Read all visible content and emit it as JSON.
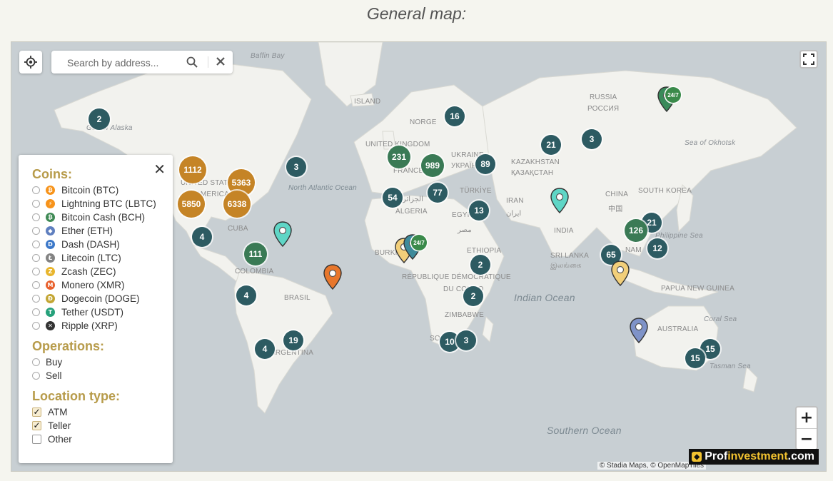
{
  "page": {
    "title": "General map:"
  },
  "search": {
    "placeholder": "Search by address..."
  },
  "attribution": "© Stadia Maps, © OpenMapTiles",
  "watermark": {
    "prefix": "Prof",
    "highlight": "investment",
    "suffix": ".com"
  },
  "filters": {
    "coins_title": "Coins:",
    "coins": [
      {
        "label": "Bitcoin (BTC)",
        "icon": "bitcoin-icon",
        "color": "#f7931a",
        "glyph": "₿"
      },
      {
        "label": "Lightning BTC (LBTC)",
        "icon": "lightning-icon",
        "color": "#f7931a",
        "glyph": "⚡"
      },
      {
        "label": "Bitcoin Cash (BCH)",
        "icon": "bitcoin-cash-icon",
        "color": "#3f8a55",
        "glyph": "₿"
      },
      {
        "label": "Ether (ETH)",
        "icon": "ether-icon",
        "color": "#5f7fbf",
        "glyph": "◆"
      },
      {
        "label": "Dash (DASH)",
        "icon": "dash-icon",
        "color": "#3b78c9",
        "glyph": "D"
      },
      {
        "label": "Litecoin (LTC)",
        "icon": "litecoin-icon",
        "color": "#838383",
        "glyph": "Ł"
      },
      {
        "label": "Zcash (ZEC)",
        "icon": "zcash-icon",
        "color": "#e8b52c",
        "glyph": "Z"
      },
      {
        "label": "Monero (XMR)",
        "icon": "monero-icon",
        "color": "#e8602c",
        "glyph": "M"
      },
      {
        "label": "Dogecoin (DOGE)",
        "icon": "dogecoin-icon",
        "color": "#c3a634",
        "glyph": "Ð"
      },
      {
        "label": "Tether (USDT)",
        "icon": "tether-icon",
        "color": "#26a17b",
        "glyph": "T"
      },
      {
        "label": "Ripple (XRP)",
        "icon": "ripple-icon",
        "color": "#333333",
        "glyph": "✕"
      }
    ],
    "operations_title": "Operations:",
    "operations": [
      {
        "label": "Buy"
      },
      {
        "label": "Sell"
      }
    ],
    "location_title": "Location type:",
    "location_types": [
      {
        "label": "ATM",
        "checked": true
      },
      {
        "label": "Teller",
        "checked": true
      },
      {
        "label": "Other",
        "checked": false
      }
    ]
  },
  "labels": {
    "baffin_bay": "Baffin Bay",
    "island": "ISLAND",
    "norge": "NORGE",
    "russia": "RUSSIA",
    "rossiya": "РОССИЯ",
    "sea_okhotsk": "Sea of Okhotsk",
    "gulf_alaska": "Gulf of Alaska",
    "united_kingdom": "UNITED KINGDOM",
    "france": "FRANCE",
    "ukraine": "UKRAINE",
    "ukraina": "УКРАЇНА",
    "kazakhstan": "KAZAKHSTAN",
    "kazakhstan_cyr": "ҚАЗАҚСТАН",
    "north_atlantic": "North Atlantic Ocean",
    "united_states": "UNITED STATES",
    "america": "AMERICA",
    "turkiye": "TÜRKİYE",
    "china": "CHINA",
    "zhongguo": "中国",
    "south_korea": "SOUTH KOREA",
    "algeria": "ALGERIA",
    "algeria_ar": "الجزائر",
    "iran": "IRAN",
    "iran_fa": "ایران",
    "egypt": "EGYPT",
    "egypt_ar": "مصر",
    "cuba": "CUBA",
    "india": "INDIA",
    "philippine_sea": "Philippine Sea",
    "burkina": "BURKINA",
    "ethiopia": "ETHIOPIA",
    "sri_lanka": "SRI LANKA",
    "sri_lanka_ta": "இலங்கை",
    "vietnam": "NAM",
    "colombia": "COLOMBIA",
    "rep_dem": "RÉPUBLIQUE DÉMOCRATIQUE",
    "du_congo": "DU CONGO",
    "papua": "PAPUA NEW GUINEA",
    "indian_ocean": "Indian Ocean",
    "brasil": "BRASIL",
    "zimbabwe": "ZIMBABWE",
    "australia": "AUSTRALIA",
    "coral_sea": "Coral Sea",
    "argentina": "ARGENTINA",
    "south_africa": "SO",
    "tasman_sea": "Tasman Sea",
    "southern_ocean": "Southern Ocean"
  },
  "clusters": [
    {
      "label": "2",
      "style": "teal"
    },
    {
      "label": "16",
      "style": "teal"
    },
    {
      "label": "21",
      "style": "teal"
    },
    {
      "label": "3",
      "style": "teal"
    },
    {
      "label": "1112",
      "style": "orange"
    },
    {
      "label": "5363",
      "style": "orange"
    },
    {
      "label": "5850",
      "style": "orange"
    },
    {
      "label": "6338",
      "style": "orange"
    },
    {
      "label": "3",
      "style": "teal"
    },
    {
      "label": "231",
      "style": "green"
    },
    {
      "label": "989",
      "style": "green"
    },
    {
      "label": "89",
      "style": "teal"
    },
    {
      "label": "54",
      "style": "teal"
    },
    {
      "label": "77",
      "style": "teal"
    },
    {
      "label": "13",
      "style": "teal"
    },
    {
      "label": "4",
      "style": "teal"
    },
    {
      "label": "111",
      "style": "green"
    },
    {
      "label": "21",
      "style": "teal"
    },
    {
      "label": "126",
      "style": "green"
    },
    {
      "label": "12",
      "style": "teal"
    },
    {
      "label": "65",
      "style": "teal"
    },
    {
      "label": "2",
      "style": "teal"
    },
    {
      "label": "2",
      "style": "teal"
    },
    {
      "label": "4",
      "style": "teal"
    },
    {
      "label": "19",
      "style": "teal"
    },
    {
      "label": "4",
      "style": "teal"
    },
    {
      "label": "10",
      "style": "teal"
    },
    {
      "label": "3",
      "style": "teal"
    },
    {
      "label": "15",
      "style": "teal"
    },
    {
      "label": "15",
      "style": "teal"
    }
  ],
  "pins": [
    {
      "name": "pin-russia",
      "color": "#3a8a5a",
      "badge": "24/7"
    },
    {
      "name": "pin-china",
      "color": "#5fd6c6",
      "badge": ""
    },
    {
      "name": "pin-caribbean",
      "color": "#5fd6c6",
      "badge": ""
    },
    {
      "name": "pin-brazil",
      "color": "#e8772c",
      "badge": ""
    },
    {
      "name": "pin-africa-yellow",
      "color": "#f2cf7a",
      "badge": ""
    },
    {
      "name": "pin-africa-teal",
      "color": "#3e8a9a",
      "badge": "24/7"
    },
    {
      "name": "pin-indonesia",
      "color": "#f2cf7a",
      "badge": ""
    },
    {
      "name": "pin-australia",
      "color": "#7f93c8",
      "badge": ""
    }
  ]
}
